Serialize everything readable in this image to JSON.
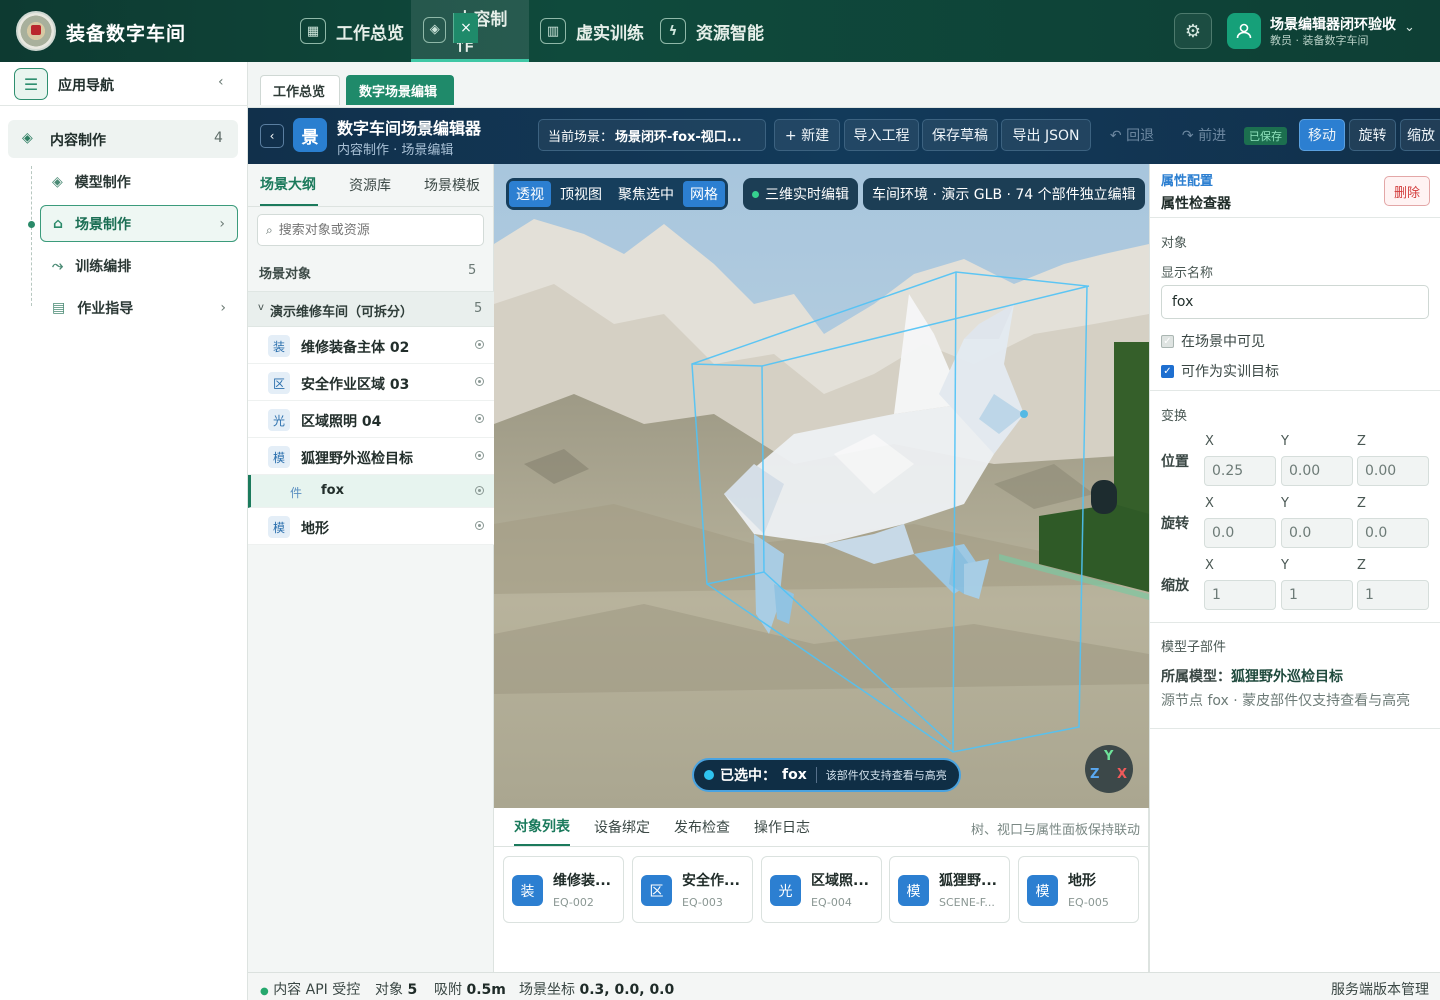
{
  "app": {
    "name": "装备数字车间"
  },
  "topnav": [
    {
      "label": "工作总览",
      "icon": "grid-icon"
    },
    {
      "label": "内容制作",
      "icon": "cube-icon"
    },
    {
      "label": "虚实训练",
      "icon": "book-icon"
    },
    {
      "label": "资源智能",
      "icon": "plug-icon"
    }
  ],
  "topnav_active": "内容制作",
  "user": {
    "name": "场景编辑器闭环验收",
    "role": "教员 · 装备数字车间"
  },
  "sidebar": {
    "title": "应用导航",
    "group": {
      "label": "内容制作",
      "count": "4"
    },
    "items": [
      {
        "label": "模型制作",
        "icon": "cube-icon"
      },
      {
        "label": "场景制作",
        "icon": "building-icon"
      },
      {
        "label": "训练编排",
        "icon": "flow-icon"
      },
      {
        "label": "作业指导",
        "icon": "doc-icon"
      }
    ],
    "selected": "场景制作"
  },
  "tabs": [
    {
      "label": "工作总览"
    },
    {
      "label": "数字场景编辑",
      "active": true
    }
  ],
  "editor": {
    "logo_char": "景",
    "title": "数字车间场景编辑器",
    "subtitle": "内容制作 · 场景编辑",
    "scene_prefix": "当前场景：",
    "scene_name": "场景闭环-fox-视口...",
    "buttons": {
      "new": "+ 新建",
      "import": "导入工程",
      "save": "保存草稿",
      "export": "导出 JSON",
      "undo": "↶ 回退",
      "redo": "↷ 前进",
      "saved": "已保存",
      "move": "移动",
      "rotate": "旋转",
      "scale": "缩放"
    }
  },
  "outline": {
    "tabs": [
      "场景大纲",
      "资源库",
      "场景模板"
    ],
    "search_placeholder": "搜索对象或资源",
    "section_title": "场景对象",
    "section_count": "5",
    "group_label": "演示维修车间（可拆分）",
    "group_count": "5",
    "group_toggle": "v",
    "rows": [
      {
        "badge": "装",
        "label": "维修装备主体 02"
      },
      {
        "badge": "区",
        "label": "安全作业区域 03"
      },
      {
        "badge": "光",
        "label": "区域照明 04"
      },
      {
        "badge": "模",
        "label": "狐狸野外巡检目标"
      },
      {
        "badge": "件",
        "label": "fox",
        "child": true
      },
      {
        "badge": "模",
        "label": "地形"
      }
    ]
  },
  "viewport": {
    "view_buttons": [
      "透视",
      "顶视图",
      "聚焦选中",
      "网格"
    ],
    "realtime_chip": "三维实时编辑",
    "env_chip": "车间环境 · 演示 GLB · 74 个部件独立编辑",
    "selected_prefix": "已选中：",
    "selected_name": "fox",
    "selected_hint": "该部件仅支持查看与高亮",
    "gizmo": {
      "x": "X",
      "y": "Y",
      "z": "Z"
    }
  },
  "bottom": {
    "tabs": [
      "对象列表",
      "设备绑定",
      "发布检查",
      "操作日志"
    ],
    "hint": "树、视口与属性面板保持联动",
    "cards": [
      {
        "badge": "装",
        "name": "维修装...",
        "code": "EQ-002"
      },
      {
        "badge": "区",
        "name": "安全作...",
        "code": "EQ-003"
      },
      {
        "badge": "光",
        "name": "区域照...",
        "code": "EQ-004"
      },
      {
        "badge": "模",
        "name": "狐狸野...",
        "code": "SCENE-F..."
      },
      {
        "badge": "模",
        "name": "地形",
        "code": "EQ-005"
      }
    ]
  },
  "inspector": {
    "header": "属性配置",
    "title": "属性检查器",
    "delete": "删除",
    "object_section": "对象",
    "display_name_label": "显示名称",
    "display_name": "fox",
    "visible_label": "在场景中可见",
    "target_label": "可作为实训目标",
    "visible_checked": true,
    "target_checked": true,
    "transform_section": "变换",
    "axes": [
      "X",
      "Y",
      "Z"
    ],
    "position_label": "位置",
    "rotation_label": "旋转",
    "scale_label": "缩放",
    "position": [
      "0.25",
      "0.00",
      "0.00"
    ],
    "rotation": [
      "0.0",
      "0.0",
      "0.0"
    ],
    "scale": [
      "1",
      "1",
      "1"
    ],
    "submodel_section": "模型子部件",
    "parent_prefix": "所属模型：",
    "parent_name": "狐狸野外巡检目标",
    "source_note": "源节点 fox · 蒙皮部件仅支持查看与高亮"
  },
  "status": {
    "api": "内容 API 受控",
    "objects_label": "对象",
    "objects": "5",
    "snap_label": "吸附",
    "snap": "0.5m",
    "coord_label": "场景坐标",
    "coord": "0.3, 0.0, 0.0",
    "right": "服务端版本管理"
  },
  "colors": {
    "brand": "#0f4a3c",
    "accent": "#1b7a5c",
    "editor": "#123a5a",
    "active": "#2c7fd1"
  }
}
